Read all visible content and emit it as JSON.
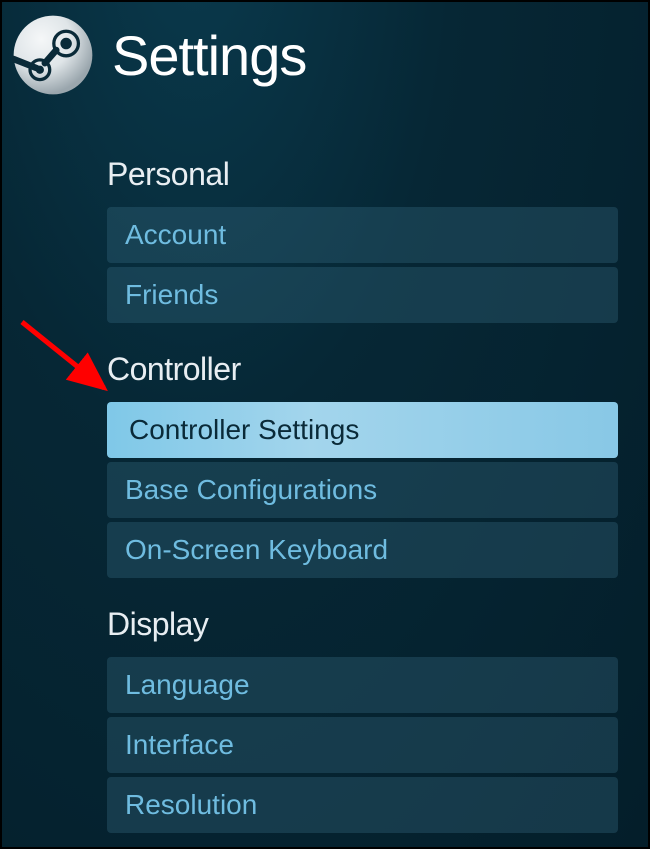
{
  "header": {
    "title": "Settings"
  },
  "sections": {
    "0": {
      "heading": "Personal",
      "items": {
        "0": {
          "label": "Account"
        },
        "1": {
          "label": "Friends"
        }
      }
    },
    "1": {
      "heading": "Controller",
      "items": {
        "0": {
          "label": "Controller Settings"
        },
        "1": {
          "label": "Base Configurations"
        },
        "2": {
          "label": "On-Screen Keyboard"
        }
      }
    },
    "2": {
      "heading": "Display",
      "items": {
        "0": {
          "label": "Language"
        },
        "1": {
          "label": "Interface"
        },
        "2": {
          "label": "Resolution"
        }
      }
    }
  }
}
